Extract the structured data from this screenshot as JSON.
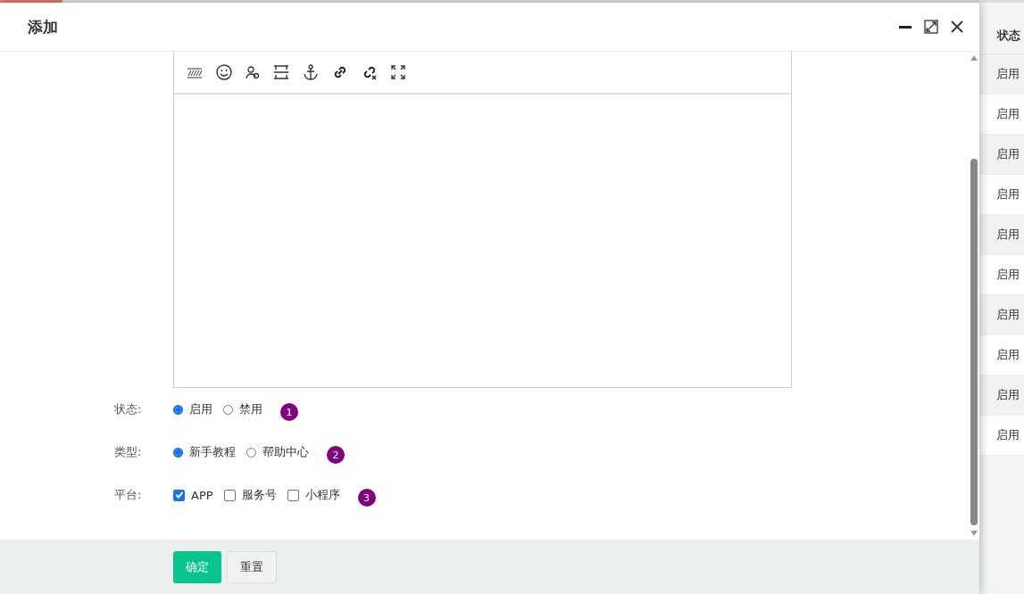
{
  "dialog": {
    "title": "添加"
  },
  "form": [
    {
      "kind": "radio",
      "label": "状态:",
      "marker": "1",
      "options": [
        {
          "label": "启用",
          "selected": true
        },
        {
          "label": "禁用",
          "selected": false
        }
      ]
    },
    {
      "kind": "radio",
      "label": "类型:",
      "marker": "2",
      "options": [
        {
          "label": "新手教程",
          "selected": true
        },
        {
          "label": "帮助中心",
          "selected": false
        }
      ]
    },
    {
      "kind": "checkbox",
      "label": "平台:",
      "marker": "3",
      "options": [
        {
          "label": "APP",
          "checked": true
        },
        {
          "label": "服务号",
          "checked": false
        },
        {
          "label": "小程序",
          "checked": false
        }
      ]
    }
  ],
  "buttons": [
    {
      "label": "确定",
      "kind": "primary"
    },
    {
      "label": "重置",
      "kind": "default"
    }
  ],
  "background_table": {
    "header": "状态",
    "rows": [
      "启用",
      "启用",
      "启用",
      "启用",
      "启用",
      "启用",
      "启用",
      "启用",
      "启用",
      "启用"
    ]
  }
}
